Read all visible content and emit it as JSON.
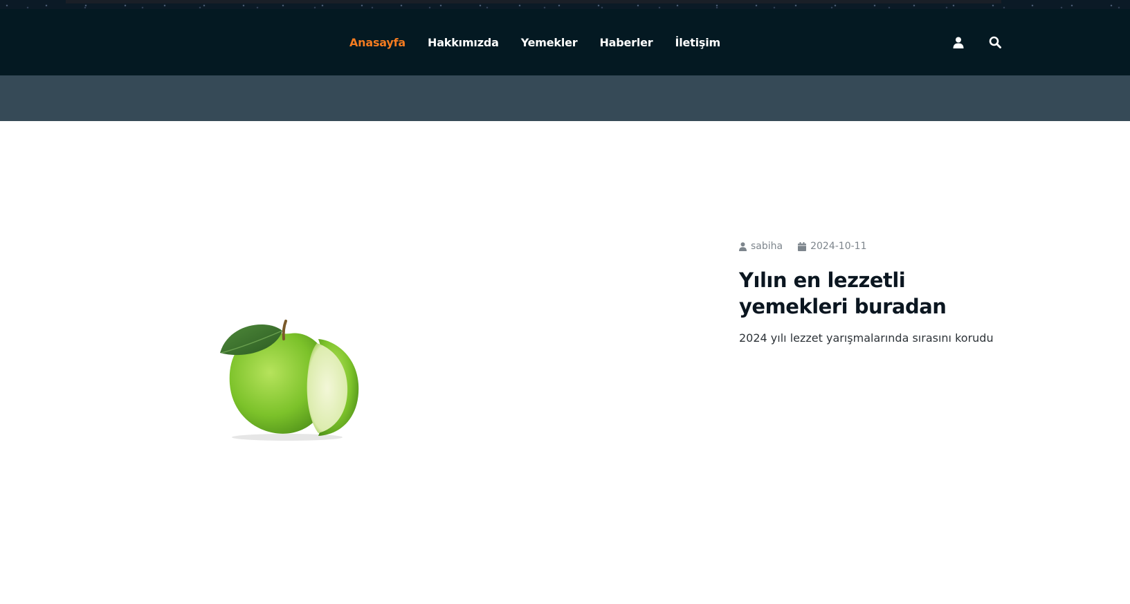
{
  "nav": {
    "items": [
      {
        "label": "Anasayfa",
        "active": true
      },
      {
        "label": "Hakkımızda",
        "active": false
      },
      {
        "label": "Yemekler",
        "active": false
      },
      {
        "label": "Haberler",
        "active": false
      },
      {
        "label": "İletişim",
        "active": false
      }
    ],
    "icons": [
      "user-icon",
      "search-icon"
    ],
    "active_color": "#f47b20",
    "background": "#041922"
  },
  "sub_band": {
    "background": "#364a57"
  },
  "post": {
    "author": "sabiha",
    "date": "2024-10-11",
    "title": "Yılın en lezzetli yemekleri buradan",
    "excerpt": "2024 yılı lezzet yarışmalarında sırasını korudu",
    "image": "green-apple"
  }
}
